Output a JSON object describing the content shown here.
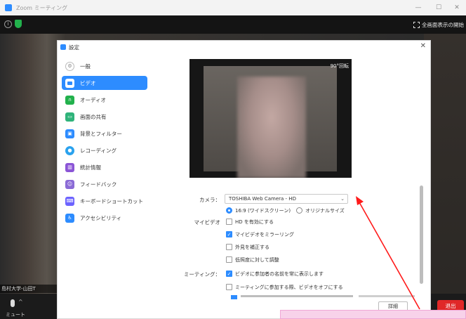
{
  "window": {
    "title": "Zoom ミーティング",
    "controls": [
      "—",
      "☐",
      "✕"
    ]
  },
  "topbar": {
    "fullscreen_label": "全画面表示の開始"
  },
  "participant": {
    "name": "島村大学-山田T"
  },
  "bottombar": {
    "mute_label": "ミュート",
    "leave_label": "退出"
  },
  "settings": {
    "title": "設定",
    "nav": [
      {
        "label": "一般",
        "icon": "gear-icon",
        "color": "#e6e6e6"
      },
      {
        "label": "ビデオ",
        "icon": "video-camera-icon",
        "color": "#2d8cff",
        "active": true
      },
      {
        "label": "オーディオ",
        "icon": "headphones-icon",
        "color": "#22b14c"
      },
      {
        "label": "画面の共有",
        "icon": "share-screen-icon",
        "color": "#2fb37a"
      },
      {
        "label": "背景とフィルター",
        "icon": "background-icon",
        "color": "#2d8cff"
      },
      {
        "label": "レコーディング",
        "icon": "record-icon",
        "color": "#2aa2ee"
      },
      {
        "label": "統計情報",
        "icon": "statistics-icon",
        "color": "#8b55d6"
      },
      {
        "label": "フィードバック",
        "icon": "feedback-icon",
        "color": "#8b6bd6"
      },
      {
        "label": "キーボードショートカット",
        "icon": "keyboard-icon",
        "color": "#6c63ff"
      },
      {
        "label": "アクセシビリティ",
        "icon": "accessibility-icon",
        "color": "#2d8cff"
      }
    ],
    "preview": {
      "rotate_label": "90°回転"
    },
    "camera_label": "カメラ：",
    "camera_value": "TOSHIBA Web Camera - HD",
    "aspect_options": [
      "16:9 (ワイドスクリーン)",
      "オリジナルサイズ"
    ],
    "my_video_label": "マイビデオ",
    "my_video_options": [
      {
        "label": "HD を有効にする",
        "checked": false
      },
      {
        "label": "マイビデオをミラーリング",
        "checked": true
      },
      {
        "label": "外見を補正する",
        "checked": false
      },
      {
        "label": "低照度に対して調整",
        "checked": false
      }
    ],
    "meeting_label": "ミーティング：",
    "meeting_options": [
      {
        "label": "ビデオに参加者の名前を常に表示します",
        "checked": true
      },
      {
        "label": "ミーティングに参加する際、ビデオをオフにする",
        "checked": false
      }
    ],
    "details_label": "詳細"
  },
  "accent_color": "#2d8cff"
}
